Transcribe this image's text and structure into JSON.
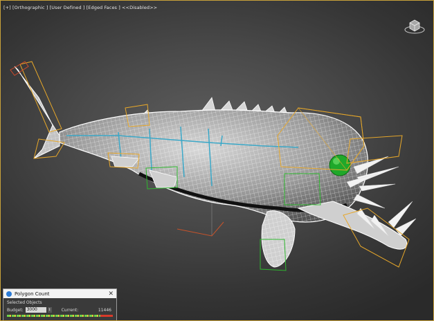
{
  "viewport": {
    "label": "[+] [Orthographic ] [User Defined ] [Edged Faces ]  <<Disabled>>",
    "viewcube_icon": "viewcube-icon",
    "wire_color": "#ffffff",
    "selection_color": "#e8a82a"
  },
  "polygon_panel": {
    "title": "Polygon Count",
    "section": "Selected Objects",
    "budget_label": "Budget:",
    "budget_value": "3000",
    "current_label": "Current:",
    "current_value": "11446"
  }
}
